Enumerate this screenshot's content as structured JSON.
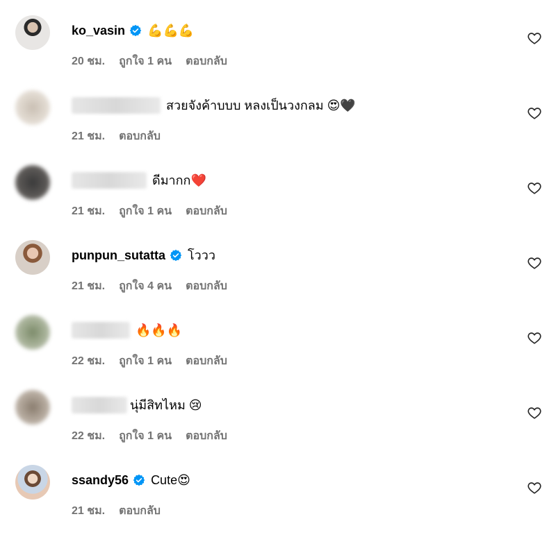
{
  "comments": [
    {
      "username": "ko_vasin",
      "verified": true,
      "text": "💪💪💪",
      "time": "20 ชม.",
      "likes": "ถูกใจ 1 คน",
      "reply": "ตอบกลับ"
    },
    {
      "username": "",
      "verified": false,
      "text": "สวยจังค้าบบบ หลงเป็นวงกลม 😍🖤",
      "time": "21 ชม.",
      "likes": "",
      "reply": "ตอบกลับ"
    },
    {
      "username": "",
      "verified": false,
      "text": "ดีมากก❤️",
      "time": "21 ชม.",
      "likes": "ถูกใจ 1 คน",
      "reply": "ตอบกลับ"
    },
    {
      "username": "punpun_sutatta",
      "verified": true,
      "text": "โววว",
      "time": "21 ชม.",
      "likes": "ถูกใจ 4 คน",
      "reply": "ตอบกลับ"
    },
    {
      "username": "",
      "verified": false,
      "text": "🔥🔥🔥",
      "time": "22 ชม.",
      "likes": "ถูกใจ 1 คน",
      "reply": "ตอบกลับ"
    },
    {
      "username": "",
      "verified": false,
      "text": "นุ่มีสิทไหม 😢",
      "time": "22 ชม.",
      "likes": "ถูกใจ 1 คน",
      "reply": "ตอบกลับ"
    },
    {
      "username": "ssandy56",
      "verified": true,
      "text": "Cute😍",
      "time": "21 ชม.",
      "likes": "",
      "reply": "ตอบกลับ"
    }
  ],
  "colors": {
    "meta": "#737373",
    "verified": "#0095f6",
    "text": "#000000"
  },
  "icons": {
    "verified": "verified-badge-icon",
    "like": "heart-outline-icon"
  }
}
